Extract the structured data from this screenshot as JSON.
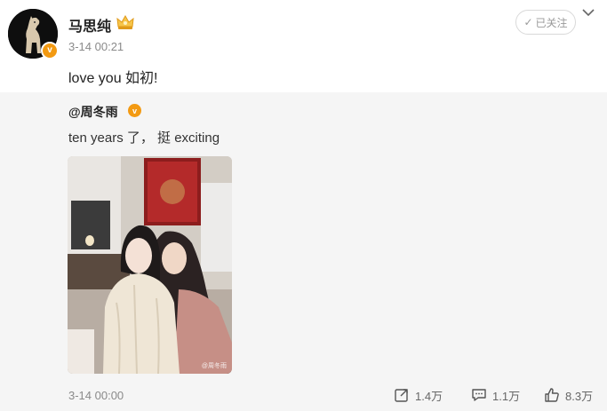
{
  "post": {
    "author": "马思纯",
    "verified_mark": "v",
    "timestamp": "3-14 00:21",
    "follow_label": "已关注",
    "follow_check": "✓",
    "text": "love you 如初!"
  },
  "repost": {
    "author": "@周冬雨",
    "verified_mark": "v",
    "text": "ten years 了， 挺 exciting",
    "image_watermark": "@周冬雨",
    "timestamp": "3-14 00:00",
    "actions": {
      "repost_count": "1.4万",
      "comment_count": "1.1万",
      "like_count": "8.3万"
    }
  },
  "colors": {
    "badge": "#f39a12",
    "repost_bg": "#f5f5f5",
    "muted_text": "#8a8a8a"
  },
  "icons": [
    "crown-icon",
    "chevron-down-icon",
    "repost-icon",
    "comment-icon",
    "like-icon"
  ]
}
